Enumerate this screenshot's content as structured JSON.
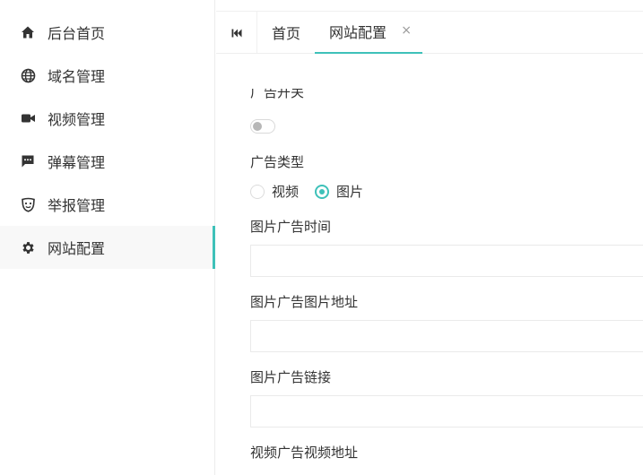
{
  "sidebar": {
    "items": [
      {
        "label": "后台首页",
        "icon": "home-icon"
      },
      {
        "label": "域名管理",
        "icon": "globe-icon"
      },
      {
        "label": "视频管理",
        "icon": "video-camera-icon"
      },
      {
        "label": "弹幕管理",
        "icon": "comment-icon"
      },
      {
        "label": "举报管理",
        "icon": "mask-icon"
      },
      {
        "label": "网站配置",
        "icon": "gear-icon",
        "active": true
      }
    ]
  },
  "tabs": {
    "prev_icon": "skip-back-icon",
    "items": [
      {
        "label": "首页"
      },
      {
        "label": "网站配置",
        "active": true,
        "close": "×"
      }
    ]
  },
  "form": {
    "ad_switch_label": "广告开关",
    "ad_switch_on": false,
    "ad_type_label": "广告类型",
    "ad_type_options": [
      "视频",
      "图片"
    ],
    "ad_type_selected": "图片",
    "image_ad_time_label": "图片广告时间",
    "image_ad_time_value": "",
    "image_ad_url_label": "图片广告图片地址",
    "image_ad_url_value": "",
    "image_ad_link_label": "图片广告链接",
    "image_ad_link_value": "",
    "video_ad_url_label": "视频广告视频地址"
  },
  "colors": {
    "accent": "#3ec1b9",
    "text": "#333333",
    "border": "#eaeaea"
  }
}
